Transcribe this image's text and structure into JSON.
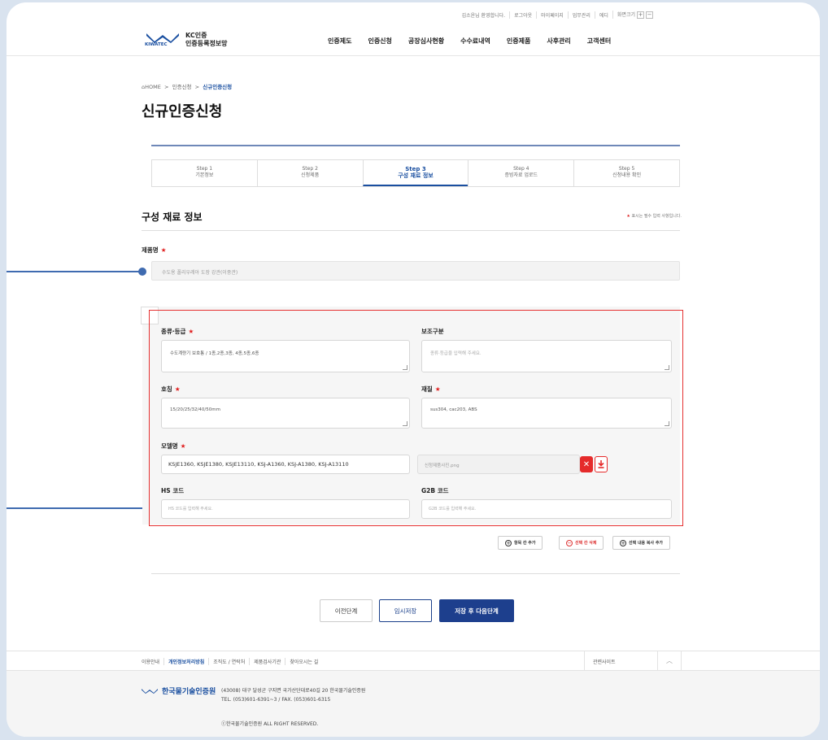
{
  "util_bar": {
    "welcome": "김소윤님 환영합니다.",
    "logout": "로그아웃",
    "mypage": "마이페이지",
    "work": "업무관리",
    "edit": "에디",
    "font_size": "화면크기",
    "plus": "+",
    "minus": "−"
  },
  "header": {
    "logo_brand": "KIWATEC",
    "logo_line1": "KC인증",
    "logo_line2": "인증등록정보망",
    "nav": [
      "인증제도",
      "인증신청",
      "공장심사현황",
      "수수료내역",
      "인증제품",
      "사후관리",
      "고객센터"
    ]
  },
  "breadcrumb": {
    "home": "HOME",
    "sep": ">",
    "level1": "인증신청",
    "current": "신규인증신청"
  },
  "page_title": "신규인증신청",
  "steps": [
    {
      "step": "Step 1",
      "label": "기본정보",
      "active": false
    },
    {
      "step": "Step 2",
      "label": "신청제품",
      "active": false
    },
    {
      "step": "Step 3",
      "label": "구성 재료 정보",
      "active": true
    },
    {
      "step": "Step 4",
      "label": "증빙자료 업로드",
      "active": false
    },
    {
      "step": "Step 5",
      "label": "신청내용 확인",
      "active": false
    }
  ],
  "section": {
    "title": "구성 재료 정보",
    "required_note_star": "★",
    "required_note": "표시는 필수 입력 사항입니다."
  },
  "product": {
    "label": "제품명",
    "star": "★",
    "value": "수도용 폴리우레아 도장 강관(이중관)"
  },
  "form": {
    "type_grade_label": "종류·등급",
    "type_grade_value": "수도계량기 보호통 / 1종,2종,3종, 4종,5종,6종",
    "aux_label": "보조구분",
    "aux_placeholder": "종류·등급을 입력해 주세요.",
    "size_label": "호칭",
    "size_value": "15/20/25/32/40/50mm",
    "material_label": "재질",
    "material_value": "sus304, cac203, ABS",
    "model_label": "모델명",
    "model_value": "KSJE1360, KSJE1380, KSJE13110, KSJ-A1360, KSJ-A1380,  KSJ-A13110",
    "file_value": "신청제품사진.png",
    "hs_label": "HS 코드",
    "hs_placeholder": "HS 코드를 입력해 주세요.",
    "g2b_label": "G2B 코드",
    "g2b_placeholder": "G2B 코드를 입력해 주세요.",
    "star": "★"
  },
  "row_actions": {
    "add_row": "항목 칸 추가",
    "delete_row": "선택 칸 삭제",
    "copy_row": "선택 내용 복사 추가"
  },
  "bottom_buttons": {
    "prev": "이전단계",
    "temp_save": "임시저장",
    "save_next": "저장 후 다음단계"
  },
  "footer": {
    "links": [
      "이용안내",
      "개인정보처리방침",
      "조직도 / 연락처",
      "제품검사기관",
      "찾아오시는 길"
    ],
    "related": "관련사이트",
    "org_name": "한국물기술인증원",
    "org_brand": "KIWATEC",
    "address": "(43008) 대구 달성군 구지면 국가산단대로40길 20 한국물기술인증원",
    "contact": "TEL. (053)601-6391~3 / FAX. (053)601-6315",
    "copyright": "ⓒ한국물기술인증원 ALL RIGHT RESERVED."
  },
  "colors": {
    "primary": "#1d3f8d",
    "accent_red": "#e53030",
    "annotation_blue": "#3f6bb0",
    "background": "#d9e3ef"
  }
}
